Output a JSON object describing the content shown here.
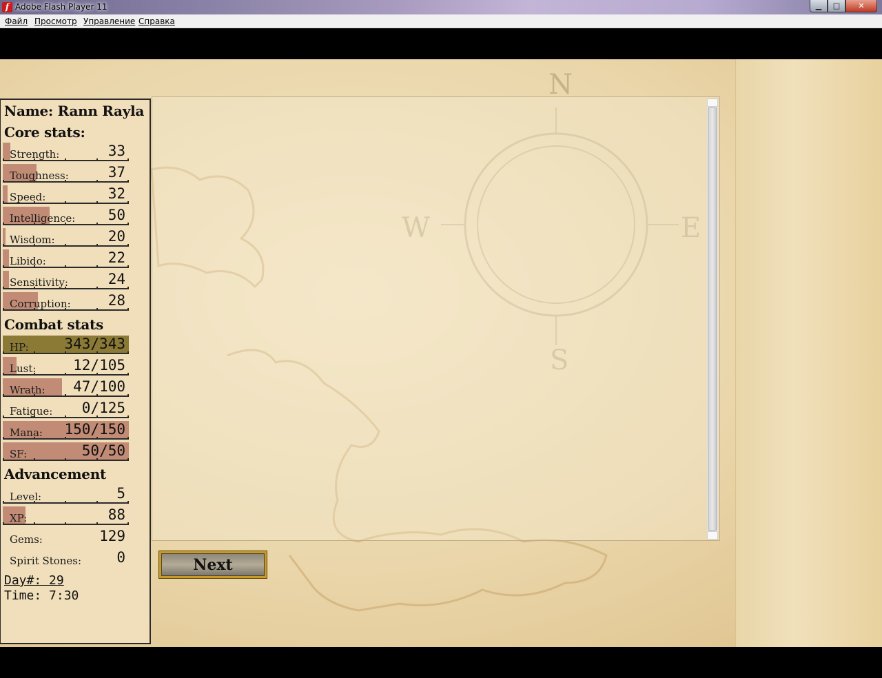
{
  "window": {
    "title": "Adobe Flash Player 11",
    "icon_glyph": "f",
    "min_glyph": "▁",
    "max_glyph": "□",
    "close_glyph": "✕"
  },
  "menu": [
    "Файл",
    "Просмотр",
    "Управление",
    "Справка"
  ],
  "player": {
    "name_line": "Name: Rann Rayla"
  },
  "sections": {
    "core": "Core stats:",
    "combat": "Combat stats",
    "advancement": "Advancement"
  },
  "core_stats": [
    {
      "label": "Strength:",
      "value": "33",
      "fill": 0.06
    },
    {
      "label": "Toughness:",
      "value": "37",
      "fill": 0.27
    },
    {
      "label": "Speed:",
      "value": "32",
      "fill": 0.04
    },
    {
      "label": "Intelligence:",
      "value": "50",
      "fill": 0.37
    },
    {
      "label": "Wisdom:",
      "value": "20",
      "fill": 0.02
    },
    {
      "label": "Libido:",
      "value": "22",
      "fill": 0.05
    },
    {
      "label": "Sensitivity:",
      "value": "24",
      "fill": 0.05
    },
    {
      "label": "Corruption:",
      "value": "28",
      "fill": 0.28
    }
  ],
  "combat_stats": [
    {
      "label": "HP:",
      "value": "343/343",
      "fill": 1.0,
      "kind": "hp"
    },
    {
      "label": "Lust:",
      "value": "12/105",
      "fill": 0.11
    },
    {
      "label": "Wrath:",
      "value": "47/100",
      "fill": 0.47
    },
    {
      "label": "Fatigue:",
      "value": "0/125",
      "fill": 0.0
    },
    {
      "label": "Mana:",
      "value": "150/150",
      "fill": 1.0
    },
    {
      "label": "SF:",
      "value": "50/50",
      "fill": 1.0
    }
  ],
  "advancement": [
    {
      "label": "Level:",
      "value": "5",
      "fill": 0.0
    },
    {
      "label": "XP:",
      "value": "88",
      "fill": 0.18
    },
    {
      "label": "Gems:",
      "value": "129",
      "fill": 0.0,
      "nobar": true
    },
    {
      "label": "Spirit Stones:",
      "value": "0",
      "fill": 0.0,
      "nobar": true
    }
  ],
  "time": {
    "day": "Day#: 29",
    "time": "Time: 7:30"
  },
  "buttons": {
    "next": "Next"
  },
  "compass": {
    "n": "N",
    "s": "S",
    "w": "W",
    "e": "E"
  },
  "colors": {
    "stat_fill": "#b97d68",
    "hp_fill": "#8a7a35",
    "parchment": "#ead6aa",
    "next_frame": "#c99a26"
  }
}
